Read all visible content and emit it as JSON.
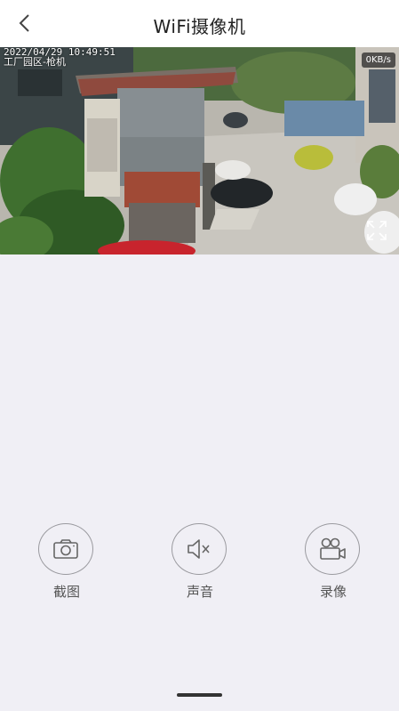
{
  "header": {
    "title": "WiFi摄像机"
  },
  "video": {
    "timestamp": "2022/04/29 10:49:51",
    "location": "工厂园区-枪机",
    "speed": "0KB/s"
  },
  "controls": {
    "screenshot_label": "截图",
    "sound_label": "声音",
    "record_label": "录像"
  }
}
